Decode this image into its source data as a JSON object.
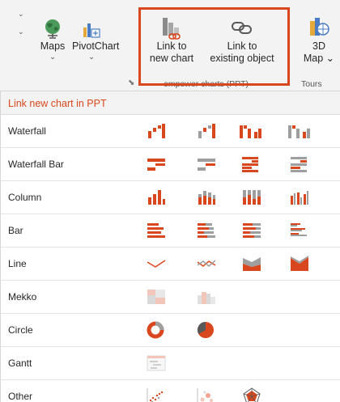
{
  "ribbon": {
    "maps": {
      "label": "Maps",
      "icon": "globe-icon"
    },
    "pivot_chart": {
      "label": "PivotChart",
      "icon": "pivot-chart-icon"
    },
    "link_new_chart": {
      "line1": "Link to",
      "line2": "new chart",
      "icon": "link-new-chart-icon"
    },
    "link_existing_object": {
      "line1": "Link to",
      "line2": "existing object",
      "icon": "chain-link-icon"
    },
    "map_3d": {
      "line1": "3D",
      "line2": "Map",
      "icon": "3d-map-icon"
    },
    "group_empower": "empower charts (PPT)",
    "group_tours": "Tours"
  },
  "panel": {
    "header": "Link new chart in PPT",
    "rows": [
      {
        "label": "Waterfall"
      },
      {
        "label": "Waterfall Bar"
      },
      {
        "label": "Column"
      },
      {
        "label": "Bar"
      },
      {
        "label": "Line"
      },
      {
        "label": "Mekko"
      },
      {
        "label": "Circle"
      },
      {
        "label": "Gantt"
      },
      {
        "label": "Other"
      }
    ]
  },
  "colors": {
    "accent": "#d9471e",
    "gray": "#9e9e9e",
    "light_gray": "#cfcfcf",
    "ribbon_bg": "#f3f3f3"
  }
}
